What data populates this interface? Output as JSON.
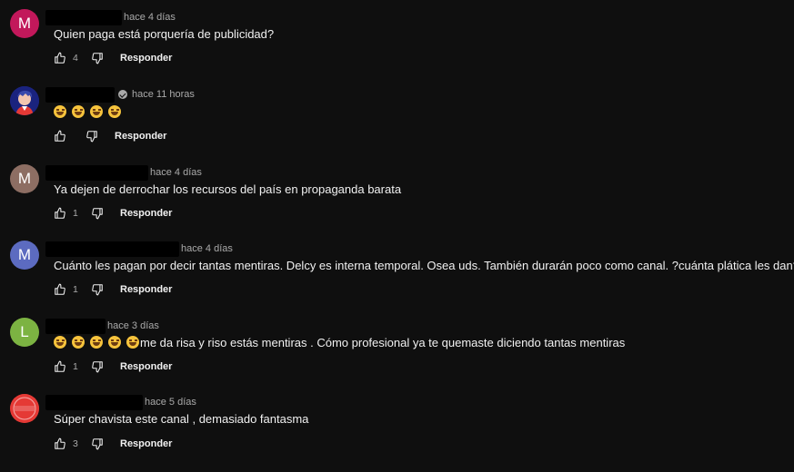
{
  "reply_label": "Responder",
  "comments": [
    {
      "avatar_letter": "M",
      "avatar_color": "#c2185b",
      "time": "hace 4 días",
      "text": "Quien paga está porquería de publicidad?",
      "likes": "4"
    },
    {
      "avatar_letter": "",
      "avatar_color": "#1a237e",
      "avatar_icon": "anime-profile-picture",
      "verified": true,
      "time": "hace 11 horas",
      "text": "",
      "emoji_count": 4,
      "likes": ""
    },
    {
      "avatar_letter": "M",
      "avatar_color": "#8d6e63",
      "time": "hace 4 días",
      "text": "Ya dejen de derrochar los recursos del país en propaganda barata",
      "likes": "1"
    },
    {
      "avatar_letter": "M",
      "avatar_color": "#5c6bc0",
      "time": "hace 4 días",
      "text": "Cuánto les pagan por decir tantas mentiras. Delcy es interna temporal. Osea uds. También durarán poco como canal. ?cuánta plática les dan???",
      "likes": "1"
    },
    {
      "avatar_letter": "L",
      "avatar_color": "#7cb342",
      "time": "hace 3 días",
      "text": "me da risa y riso estás mentiras  . Cómo profesional ya te quemaste diciendo tantas mentiras",
      "emoji_count": 5,
      "likes": "1"
    },
    {
      "avatar_letter": "",
      "avatar_color": "#e53935",
      "avatar_icon": "red-round-logo",
      "avatar_logo_text": "Defender",
      "time": "hace 5 días",
      "text": "Súper chavista este canal , demasiado fantasma",
      "likes": "3"
    }
  ]
}
